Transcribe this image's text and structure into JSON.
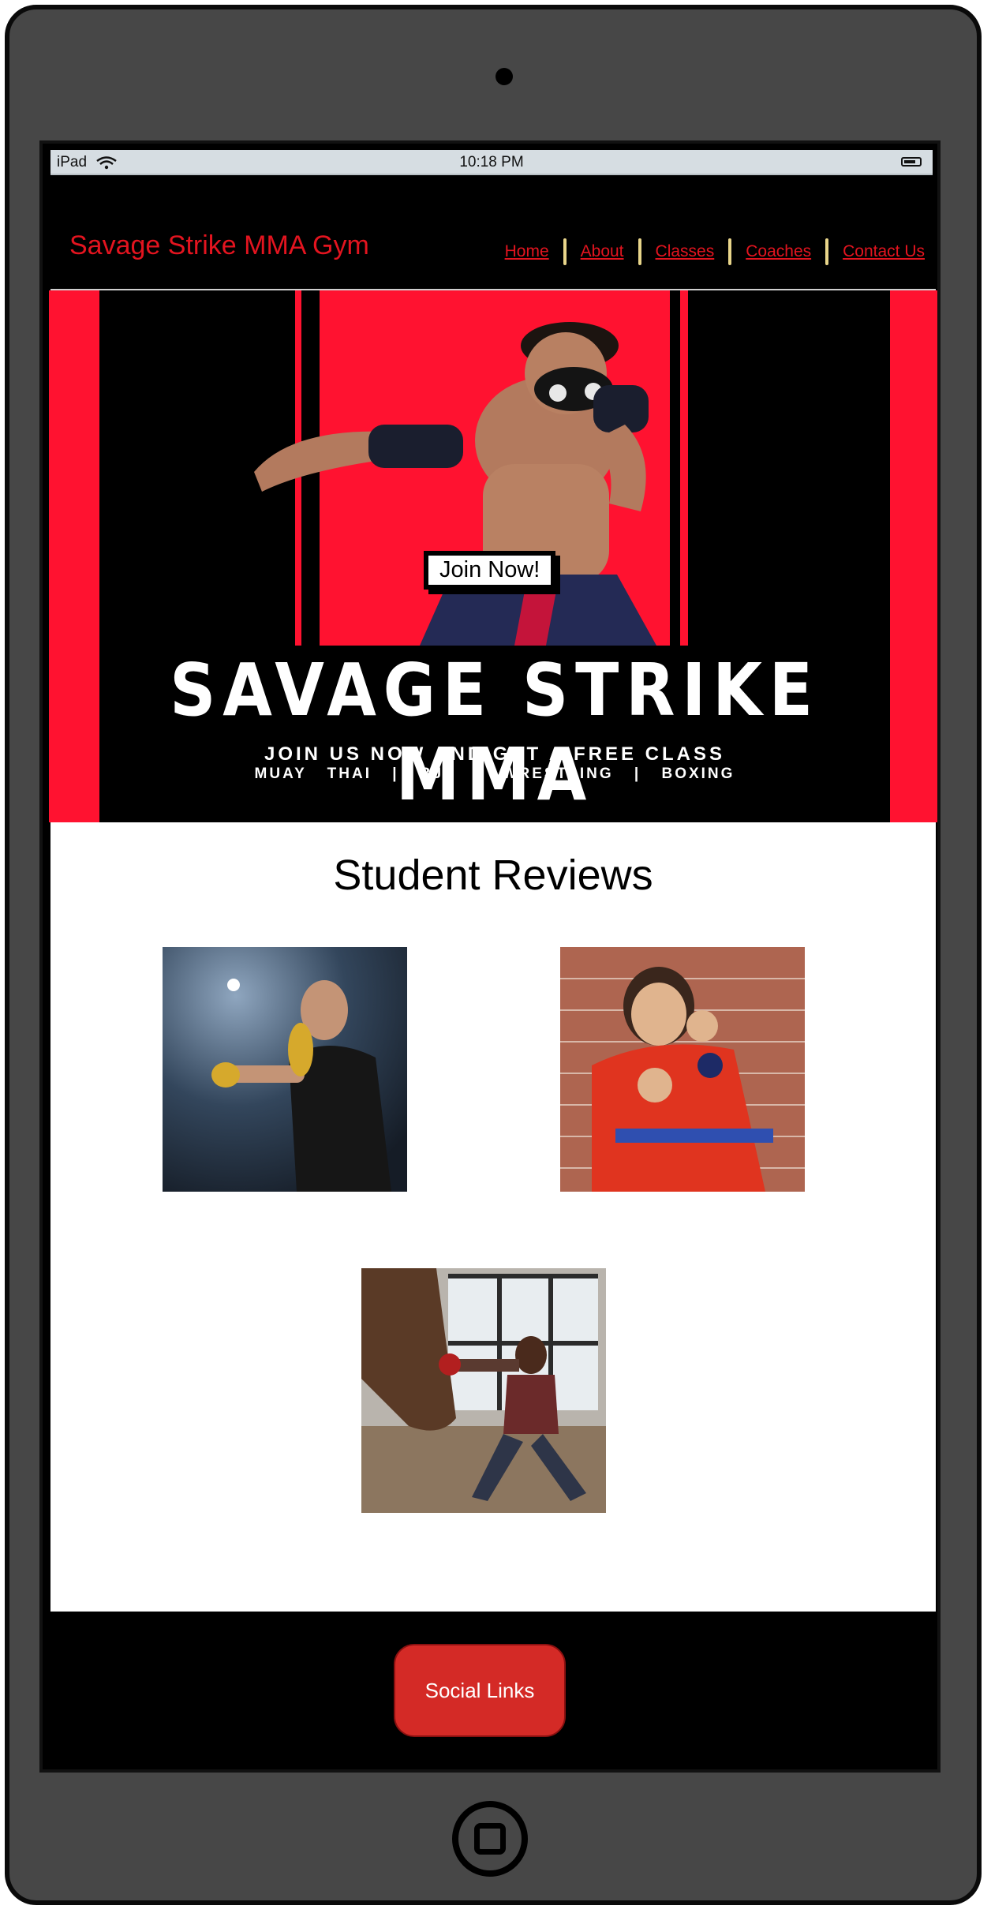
{
  "status_bar": {
    "device": "iPad",
    "time": "10:18 PM",
    "icons": [
      "wifi-icon",
      "battery-icon"
    ]
  },
  "header": {
    "site_title": "Savage Strike MMA Gym",
    "nav": [
      "Home",
      "About",
      "Classes",
      "Coaches",
      "Contact Us"
    ]
  },
  "hero": {
    "button": "Join Now!",
    "title": "SAVAGE STRIKE MMA",
    "subtitle": "JOIN US NOW AND GET A FREE CLASS",
    "tags": "MUAY THAI | BJJ | WRESTLING | BOXING"
  },
  "reviews": {
    "title": "Student Reviews",
    "photos": [
      "boxer-smoke-photo",
      "kid-karate-photo",
      "woman-heavy-bag-photo"
    ]
  },
  "footer": {
    "social_button": "Social Links"
  },
  "colors": {
    "brand_red": "#e3141f",
    "hero_red": "#ff1230",
    "button_red": "#d42a26",
    "nav_divider": "#e8d58a",
    "device_gray": "#474747"
  }
}
